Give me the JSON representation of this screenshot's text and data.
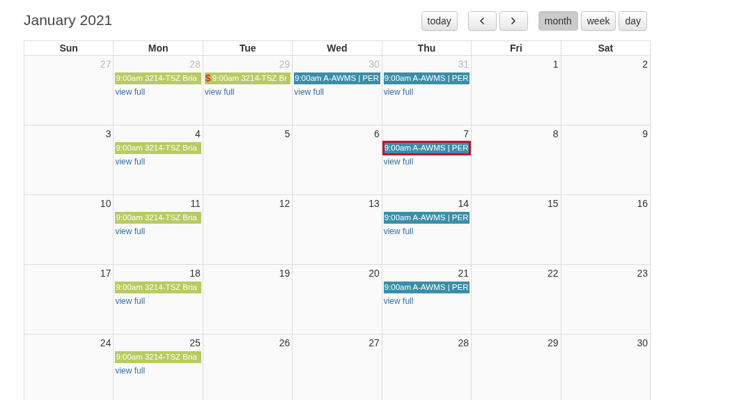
{
  "title": "January 2021",
  "toolbar": [
    {
      "kind": "text",
      "label": "today",
      "selected": false
    },
    {
      "kind": "prev",
      "selected": false
    },
    {
      "kind": "next",
      "selected": false
    },
    {
      "kind": "text",
      "label": "month",
      "selected": true
    },
    {
      "kind": "text",
      "label": "week",
      "selected": false
    },
    {
      "kind": "text",
      "label": "day",
      "selected": false
    }
  ],
  "weekdays": [
    "Sun",
    "Mon",
    "Tue",
    "Wed",
    "Thu",
    "Fri",
    "Sat"
  ],
  "weeks": [
    [
      {
        "number": "27",
        "other_month": true
      },
      {
        "number": "28",
        "other_month": true,
        "events": [
          {
            "text": "9:00am 3214-TSZ Bria",
            "color": "#b8cb62",
            "selected": false
          }
        ],
        "link": "view full"
      },
      {
        "number": "29",
        "other_month": true,
        "events": [
          {
            "prefix": "$",
            "text": "9:00am 3214-TSZ Br",
            "color": "#b8cb62",
            "selected": false
          }
        ],
        "link": "view full"
      },
      {
        "number": "30",
        "other_month": true,
        "events": [
          {
            "text": "9:00am A-AWMS | PER",
            "color": "#3a8ea8",
            "selected": false
          }
        ],
        "link": "view full"
      },
      {
        "number": "31",
        "other_month": true,
        "events": [
          {
            "text": "9:00am A-AWMS | PER",
            "color": "#3a8ea8",
            "selected": false
          }
        ],
        "link": "view full"
      },
      {
        "number": "1",
        "other_month": false
      },
      {
        "number": "2",
        "other_month": false
      }
    ],
    [
      {
        "number": "3",
        "other_month": false
      },
      {
        "number": "4",
        "other_month": false,
        "events": [
          {
            "text": "9:00am 3214-TSZ Bria",
            "color": "#b8cb62",
            "selected": false
          }
        ],
        "link": "view full"
      },
      {
        "number": "5",
        "other_month": false
      },
      {
        "number": "6",
        "other_month": false
      },
      {
        "number": "7",
        "other_month": false,
        "events": [
          {
            "text": "9:00am A-AWMS | PER",
            "color": "#3a8ea8",
            "selected": true
          }
        ],
        "link": "view full"
      },
      {
        "number": "8",
        "other_month": false
      },
      {
        "number": "9",
        "other_month": false
      }
    ],
    [
      {
        "number": "10",
        "other_month": false
      },
      {
        "number": "11",
        "other_month": false,
        "events": [
          {
            "text": "9:00am 3214-TSZ Bria",
            "color": "#b8cb62",
            "selected": false
          }
        ],
        "link": "view full"
      },
      {
        "number": "12",
        "other_month": false
      },
      {
        "number": "13",
        "other_month": false
      },
      {
        "number": "14",
        "other_month": false,
        "events": [
          {
            "text": "9:00am A-AWMS | PER",
            "color": "#3a8ea8",
            "selected": false
          }
        ],
        "link": "view full"
      },
      {
        "number": "15",
        "other_month": false
      },
      {
        "number": "16",
        "other_month": false
      }
    ],
    [
      {
        "number": "17",
        "other_month": false
      },
      {
        "number": "18",
        "other_month": false,
        "events": [
          {
            "text": "9:00am 3214-TSZ Bria",
            "color": "#b8cb62",
            "selected": false
          }
        ],
        "link": "view full"
      },
      {
        "number": "19",
        "other_month": false
      },
      {
        "number": "20",
        "other_month": false
      },
      {
        "number": "21",
        "other_month": false,
        "events": [
          {
            "text": "9:00am A-AWMS | PER",
            "color": "#3a8ea8",
            "selected": false
          }
        ],
        "link": "view full"
      },
      {
        "number": "22",
        "other_month": false
      },
      {
        "number": "23",
        "other_month": false
      }
    ],
    [
      {
        "number": "24",
        "other_month": false
      },
      {
        "number": "25",
        "other_month": false,
        "events": [
          {
            "text": "9:00am 3214-TSZ Bria",
            "color": "#b8cb62",
            "selected": false
          }
        ],
        "link": "view full"
      },
      {
        "number": "26",
        "other_month": false
      },
      {
        "number": "27",
        "other_month": false
      },
      {
        "number": "28",
        "other_month": false
      },
      {
        "number": "29",
        "other_month": false
      },
      {
        "number": "30",
        "other_month": false
      }
    ]
  ]
}
